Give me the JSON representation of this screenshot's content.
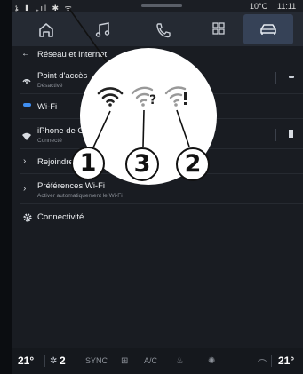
{
  "status_bar": {
    "left_icons": "ኔ ▮ ₊ıl ✱ ᯤ",
    "temperature": "10°C",
    "time": "11:11"
  },
  "nav_bar": {
    "items": [
      {
        "icon": "home-icon"
      },
      {
        "icon": "music-icon"
      },
      {
        "icon": "phone-icon"
      },
      {
        "icon": "apps-grid-icon"
      },
      {
        "icon": "car-icon",
        "active": true
      }
    ]
  },
  "list": {
    "header": {
      "back": "←",
      "title": "Réseau et Internet"
    },
    "rows": [
      {
        "title": "Point d'accès",
        "subtitle": "Désactivé",
        "icon": "hotspot-icon"
      },
      {
        "title": "Wi-Fi",
        "subtitle": "",
        "icon": "wifi-toggle-icon"
      },
      {
        "title": "iPhone de Greg",
        "subtitle": "Connecté",
        "icon": "wifi-connected-icon"
      },
      {
        "title": "Rejoindre un autre réseau",
        "subtitle": "",
        "icon": "chevron-right-icon"
      },
      {
        "title": "Préférences Wi-Fi",
        "subtitle": "Activer automatiquement le Wi-Fi",
        "icon": "chevron-right-icon"
      },
      {
        "title": "Connectivité",
        "subtitle": "",
        "icon": "gear-icon"
      }
    ]
  },
  "callout": {
    "numbers": [
      "1",
      "3",
      "2"
    ],
    "wifi_states": [
      "wifi-full-icon",
      "wifi-question-icon",
      "wifi-exclamation-icon"
    ]
  },
  "climate_bar": {
    "left_temp": "21°",
    "fan_level": "2",
    "sync": "SYNC",
    "ac": "A/C",
    "right_temp": "21°"
  }
}
